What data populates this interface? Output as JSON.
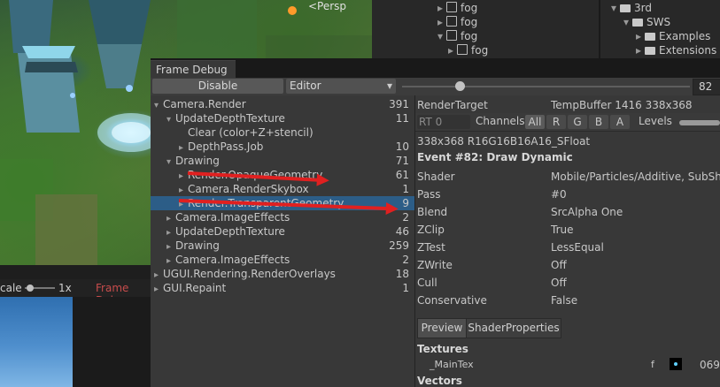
{
  "scene": {
    "label": "<Persp"
  },
  "hierarchy": {
    "left_items": [
      "fog",
      "fog",
      "fog",
      "fog"
    ],
    "right_items": [
      "3rd",
      "SWS",
      "Examples",
      "Extensions"
    ]
  },
  "frame_debug": {
    "tab_title": "Frame Debug",
    "toolbar": {
      "disable_label": "Disable",
      "target": "Editor",
      "event_index": "82"
    },
    "events": [
      {
        "label": "Camera.Render",
        "count": "391"
      },
      {
        "label": "UpdateDepthTexture",
        "count": "11"
      },
      {
        "label": "Clear (color+Z+stencil)",
        "count": ""
      },
      {
        "label": "DepthPass.Job",
        "count": "10"
      },
      {
        "label": "Drawing",
        "count": "71"
      },
      {
        "label": "Render.OpaqueGeometry",
        "count": "61"
      },
      {
        "label": "Camera.RenderSkybox",
        "count": "1"
      },
      {
        "label": "Render.TransparentGeometry",
        "count": "9"
      },
      {
        "label": "Camera.ImageEffects",
        "count": "2"
      },
      {
        "label": "UpdateDepthTexture",
        "count": "46"
      },
      {
        "label": "Drawing",
        "count": "259"
      },
      {
        "label": "Camera.ImageEffects",
        "count": "2"
      },
      {
        "label": "UGUI.Rendering.RenderOverlays",
        "count": "18"
      },
      {
        "label": "GUI.Repaint",
        "count": "1"
      }
    ],
    "details": {
      "render_target_label": "RenderTarget",
      "render_target_value": "TempBuffer 1416 338x368",
      "rt_select": "RT 0",
      "channels_label": "Channels",
      "channels": [
        "All",
        "R",
        "G",
        "B",
        "A"
      ],
      "levels_label": "Levels",
      "format": "338x368 R16G16B16A16_SFloat",
      "event_title": "Event #82: Draw Dynamic",
      "props": [
        {
          "name": "Shader",
          "value": "Mobile/Particles/Additive, SubShader"
        },
        {
          "name": "Pass",
          "value": "#0"
        },
        {
          "name": "Blend",
          "value": "SrcAlpha One"
        },
        {
          "name": "ZClip",
          "value": "True"
        },
        {
          "name": "ZTest",
          "value": "LessEqual"
        },
        {
          "name": "ZWrite",
          "value": "Off"
        },
        {
          "name": "Cull",
          "value": "Off"
        },
        {
          "name": "Conservative",
          "value": "False"
        }
      ],
      "tabs": [
        "Preview",
        "ShaderProperties"
      ],
      "textures_heading": "Textures",
      "texture_name": "_MainTex",
      "texture_flag": "f",
      "texture_value": "069",
      "vectors_heading": "Vectors"
    }
  },
  "scene_bar": {
    "scale_label": "cale",
    "scale_value": "1x",
    "frame_debug_tab": "Frame Debu"
  }
}
